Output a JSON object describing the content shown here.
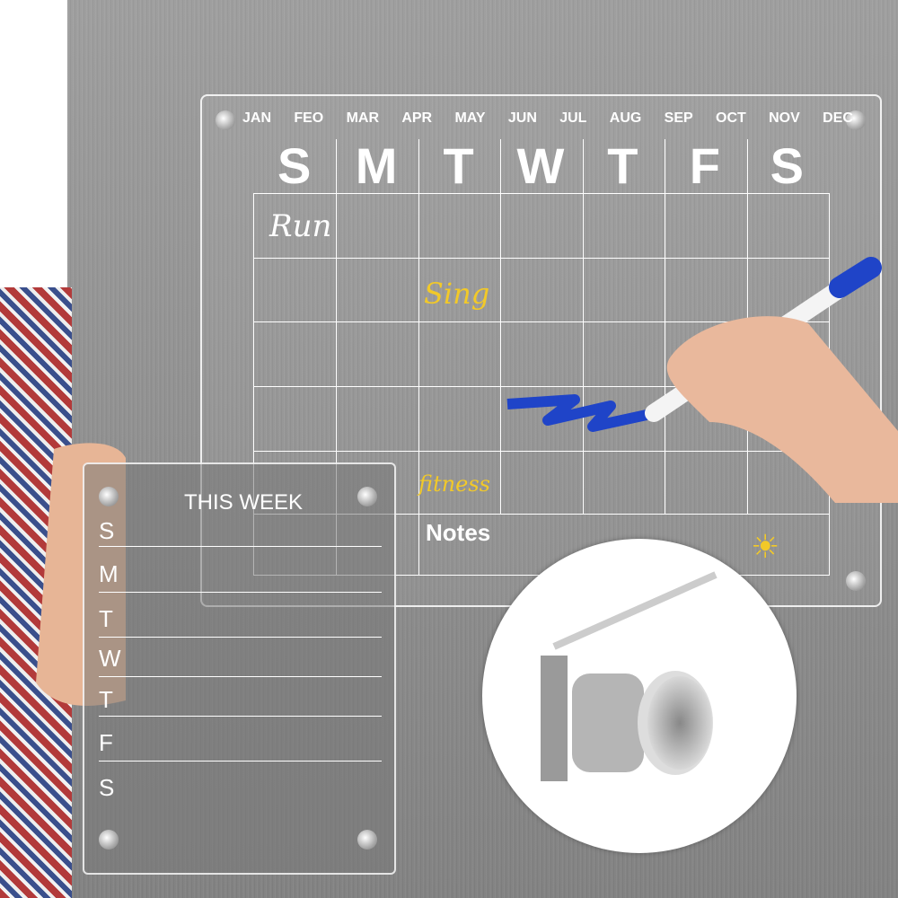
{
  "calendar": {
    "months": [
      "JAN",
      "FEO",
      "MAR",
      "APR",
      "MAY",
      "JUN",
      "JUL",
      "AUG",
      "SEP",
      "OCT",
      "NOV",
      "DEC"
    ],
    "days": [
      "S",
      "M",
      "T",
      "W",
      "T",
      "F",
      "S"
    ],
    "notes_label": "Notes",
    "handwriting": {
      "run": "Run",
      "sing": "Sing",
      "fitness": "fitness"
    },
    "colors": {
      "handwriting_yellow": "#f2c928",
      "marker_blue": "#1f44c8"
    }
  },
  "weekly": {
    "title": "THIS WEEK",
    "days": [
      "S",
      "M",
      "T",
      "W",
      "T",
      "F",
      "S"
    ]
  },
  "icons": {
    "sun": "sun-icon",
    "marker": "marker-pen",
    "magnet": "magnet-mount"
  }
}
